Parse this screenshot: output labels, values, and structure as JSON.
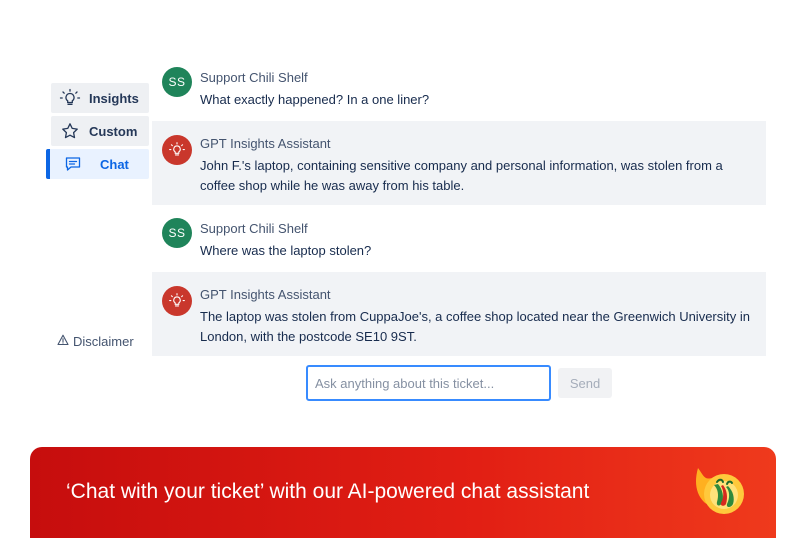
{
  "sidebar": {
    "items": [
      {
        "label": "Insights",
        "icon": "lightbulb-icon"
      },
      {
        "label": "Custom",
        "icon": "star-icon"
      },
      {
        "label": "Chat",
        "icon": "chat-icon",
        "active": true
      }
    ],
    "disclaimer": {
      "icon": "warning-icon",
      "label": "Disclaimer"
    }
  },
  "chat": {
    "messages": [
      {
        "role": "user",
        "avatar": "SS",
        "sender": "Support Chili Shelf",
        "text": "What exactly happened? In a one liner?"
      },
      {
        "role": "assistant",
        "avatar": "lightbulb-icon",
        "sender": "GPT Insights Assistant",
        "text": "John F.'s laptop, containing sensitive company and personal information, was stolen from a coffee shop while he was away from his table."
      },
      {
        "role": "user",
        "avatar": "SS",
        "sender": "Support Chili Shelf",
        "text": "Where was the laptop stolen?"
      },
      {
        "role": "assistant",
        "avatar": "lightbulb-icon",
        "sender": "GPT Insights Assistant",
        "text": "The laptop was stolen from CuppaJoe's, a coffee shop located near the Greenwich University in London, with the postcode SE10 9ST."
      }
    ],
    "input": {
      "placeholder": "Ask anything about this ticket...",
      "value": ""
    },
    "send_label": "Send"
  },
  "banner": {
    "text": "‘Chat with your ticket’ with our AI-powered chat assistant",
    "logo": "chili-logo-icon"
  },
  "colors": {
    "accent": "#0c66e4",
    "user_avatar": "#1f845a",
    "assistant_avatar": "#c9372c",
    "banner_start": "#c60d0d",
    "banner_end": "#ef3a1c"
  }
}
